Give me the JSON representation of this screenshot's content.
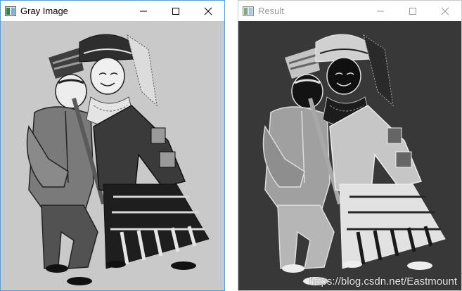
{
  "left_window": {
    "title": "Gray Image",
    "canvas_color": "#c9c9c9",
    "icons": {
      "app": "opencv-window-icon",
      "minimize": "minimize-icon",
      "maximize": "maximize-icon",
      "close": "close-icon"
    }
  },
  "right_window": {
    "title": "Result",
    "canvas_color": "#383838",
    "icons": {
      "app": "opencv-window-icon",
      "minimize": "minimize-icon",
      "maximize": "maximize-icon",
      "close": "close-icon"
    }
  },
  "image": {
    "subject": "illustration of a couple in traditional Miao costume, man playing a reed pipe and woman with silver headdress",
    "left_tone": "grayscale",
    "right_tone": "inverted grayscale"
  },
  "watermark": "https://blog.csdn.net/Eastmount"
}
